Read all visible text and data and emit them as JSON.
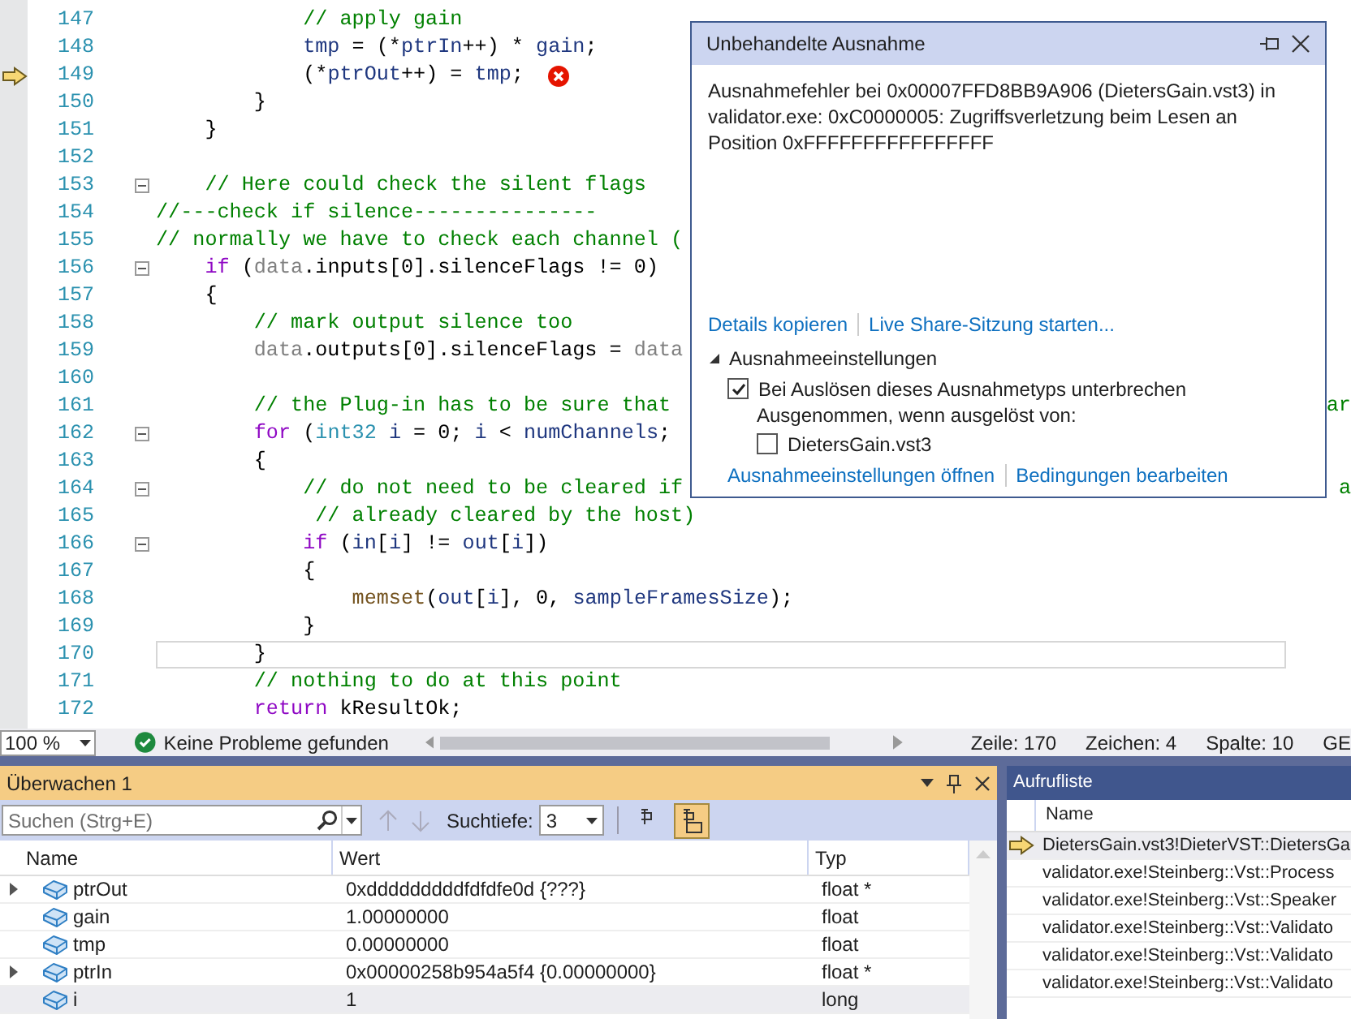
{
  "editor": {
    "lines": [
      {
        "number": "147",
        "execution_point": false,
        "caret_line": false,
        "has_error": false,
        "collapsible": false,
        "segments": [
          {
            "kind": "comment",
            "text": "            // apply gain"
          }
        ]
      },
      {
        "number": "148",
        "execution_point": false,
        "caret_line": false,
        "has_error": false,
        "collapsible": false,
        "segments": [
          {
            "kind": "var",
            "text": "            tmp"
          },
          {
            "kind": "plain",
            "text": " = (*"
          },
          {
            "kind": "var",
            "text": "ptrIn"
          },
          {
            "kind": "plain",
            "text": "++) * "
          },
          {
            "kind": "var",
            "text": "gain"
          },
          {
            "kind": "plain",
            "text": ";"
          }
        ]
      },
      {
        "number": "149",
        "execution_point": true,
        "caret_line": false,
        "has_error": true,
        "collapsible": false,
        "segments": [
          {
            "kind": "plain",
            "text": "            (*"
          },
          {
            "kind": "var",
            "text": "ptrOut"
          },
          {
            "kind": "plain",
            "text": "++) = "
          },
          {
            "kind": "var",
            "text": "tmp"
          },
          {
            "kind": "plain",
            "text": ";"
          }
        ]
      },
      {
        "number": "150",
        "execution_point": false,
        "caret_line": false,
        "has_error": false,
        "collapsible": false,
        "segments": [
          {
            "kind": "plain",
            "text": "        }"
          }
        ]
      },
      {
        "number": "151",
        "execution_point": false,
        "caret_line": false,
        "has_error": false,
        "collapsible": false,
        "segments": [
          {
            "kind": "plain",
            "text": "    }"
          }
        ]
      },
      {
        "number": "152",
        "execution_point": false,
        "caret_line": false,
        "has_error": false,
        "collapsible": false
      },
      {
        "number": "153",
        "execution_point": false,
        "caret_line": false,
        "has_error": false,
        "collapsible": true,
        "segments": [
          {
            "kind": "comment",
            "text": "    // Here could check the silent flags"
          }
        ]
      },
      {
        "number": "154",
        "execution_point": false,
        "caret_line": false,
        "has_error": false,
        "collapsible": false,
        "segments": [
          {
            "kind": "comment",
            "text": "//---check if silence---------------"
          }
        ]
      },
      {
        "number": "155",
        "execution_point": false,
        "caret_line": false,
        "has_error": false,
        "collapsible": false,
        "segments": [
          {
            "kind": "comment",
            "text": "// normally we have to check each channel ("
          }
        ]
      },
      {
        "number": "156",
        "execution_point": false,
        "caret_line": false,
        "has_error": false,
        "collapsible": true,
        "segments": [
          {
            "kind": "keyword",
            "text": "    if"
          },
          {
            "kind": "plain",
            "text": " ("
          },
          {
            "kind": "param",
            "text": "data"
          },
          {
            "kind": "plain",
            "text": ".inputs[0].silenceFlags != 0)"
          }
        ]
      },
      {
        "number": "157",
        "execution_point": false,
        "caret_line": false,
        "has_error": false,
        "collapsible": false,
        "segments": [
          {
            "kind": "plain",
            "text": "    {"
          }
        ]
      },
      {
        "number": "158",
        "execution_point": false,
        "caret_line": false,
        "has_error": false,
        "collapsible": false,
        "segments": [
          {
            "kind": "comment",
            "text": "        // mark output silence too"
          }
        ]
      },
      {
        "number": "159",
        "execution_point": false,
        "caret_line": false,
        "has_error": false,
        "collapsible": false,
        "segments": [
          {
            "kind": "param",
            "text": "        data"
          },
          {
            "kind": "plain",
            "text": ".outputs[0].silenceFlags = "
          },
          {
            "kind": "param",
            "text": "data"
          }
        ]
      },
      {
        "number": "160",
        "execution_point": false,
        "caret_line": false,
        "has_error": false,
        "collapsible": false
      },
      {
        "number": "161",
        "execution_point": false,
        "caret_line": false,
        "has_error": false,
        "collapsible": false,
        "segments": [
          {
            "kind": "comment",
            "text": "        // the Plug-in has to be sure that"
          }
        ],
        "tail": "ar"
      },
      {
        "number": "162",
        "execution_point": false,
        "caret_line": false,
        "has_error": false,
        "collapsible": true,
        "segments": [
          {
            "kind": "keyword",
            "text": "        for"
          },
          {
            "kind": "plain",
            "text": " ("
          },
          {
            "kind": "type",
            "text": "int32"
          },
          {
            "kind": "var",
            "text": " i"
          },
          {
            "kind": "plain",
            "text": " = 0; "
          },
          {
            "kind": "var",
            "text": "i"
          },
          {
            "kind": "plain",
            "text": " < "
          },
          {
            "kind": "var",
            "text": "numChannels"
          },
          {
            "kind": "plain",
            "text": ";"
          }
        ]
      },
      {
        "number": "163",
        "execution_point": false,
        "caret_line": false,
        "has_error": false,
        "collapsible": false,
        "segments": [
          {
            "kind": "plain",
            "text": "        {"
          }
        ]
      },
      {
        "number": "164",
        "execution_point": false,
        "caret_line": false,
        "has_error": false,
        "collapsible": true,
        "segments": [
          {
            "kind": "comment",
            "text": "            // do not need to be cleared if"
          }
        ],
        "tail": "a"
      },
      {
        "number": "165",
        "execution_point": false,
        "caret_line": false,
        "has_error": false,
        "collapsible": false,
        "segments": [
          {
            "kind": "comment",
            "text": "             // already cleared by the host)"
          }
        ]
      },
      {
        "number": "166",
        "execution_point": false,
        "caret_line": false,
        "has_error": false,
        "collapsible": true,
        "segments": [
          {
            "kind": "keyword",
            "text": "            if"
          },
          {
            "kind": "plain",
            "text": " ("
          },
          {
            "kind": "var",
            "text": "in"
          },
          {
            "kind": "plain",
            "text": "["
          },
          {
            "kind": "var",
            "text": "i"
          },
          {
            "kind": "plain",
            "text": "] != "
          },
          {
            "kind": "var",
            "text": "out"
          },
          {
            "kind": "plain",
            "text": "["
          },
          {
            "kind": "var",
            "text": "i"
          },
          {
            "kind": "plain",
            "text": "])"
          }
        ]
      },
      {
        "number": "167",
        "execution_point": false,
        "caret_line": false,
        "has_error": false,
        "collapsible": false,
        "segments": [
          {
            "kind": "plain",
            "text": "            {"
          }
        ]
      },
      {
        "number": "168",
        "execution_point": false,
        "caret_line": false,
        "has_error": false,
        "collapsible": false,
        "segments": [
          {
            "kind": "func",
            "text": "                memset"
          },
          {
            "kind": "plain",
            "text": "("
          },
          {
            "kind": "var",
            "text": "out"
          },
          {
            "kind": "plain",
            "text": "["
          },
          {
            "kind": "var",
            "text": "i"
          },
          {
            "kind": "plain",
            "text": "], 0, "
          },
          {
            "kind": "var",
            "text": "sampleFramesSize"
          },
          {
            "kind": "plain",
            "text": ");"
          }
        ]
      },
      {
        "number": "169",
        "execution_point": false,
        "caret_line": false,
        "has_error": false,
        "collapsible": false,
        "segments": [
          {
            "kind": "plain",
            "text": "            }"
          }
        ]
      },
      {
        "number": "170",
        "execution_point": false,
        "caret_line": true,
        "has_error": false,
        "collapsible": false,
        "segments": [
          {
            "kind": "plain",
            "text": "        }"
          }
        ]
      },
      {
        "number": "171",
        "execution_point": false,
        "caret_line": false,
        "has_error": false,
        "collapsible": false,
        "segments": [
          {
            "kind": "comment",
            "text": "        // nothing to do at this point"
          }
        ]
      },
      {
        "number": "172",
        "execution_point": false,
        "caret_line": false,
        "has_error": false,
        "collapsible": false,
        "segments": [
          {
            "kind": "keyword",
            "text": "        return"
          },
          {
            "kind": "plain",
            "text": " kResultOk;"
          }
        ]
      }
    ]
  },
  "exception_popup": {
    "title": "Unbehandelte Ausnahme",
    "message": "Ausnahmefehler bei 0x00007FFD8BB9A906 (DietersGain.vst3) in validator.exe: 0xC0000005: Zugriffsverletzung beim Lesen an Position 0xFFFFFFFFFFFFFFFF",
    "links": [
      "Details kopieren",
      "Live Share-Sitzung starten..."
    ],
    "settings": {
      "label": "Ausnahmeeinstellungen",
      "expanded": true,
      "break_option": {
        "label": "Bei Auslösen dieses Ausnahmetyps unterbrechen",
        "checked": true
      },
      "except_label": "Ausgenommen, wenn ausgelöst von:",
      "except_modules": [
        {
          "label": "DietersGain.vst3",
          "checked": false
        }
      ]
    },
    "footer_links": [
      "Ausnahmeeinstellungen öffnen",
      "Bedingungen bearbeiten"
    ]
  },
  "status_bar": {
    "zoom": "100 %",
    "problems": "Keine Probleme gefunden",
    "position": [
      "Zeile: 170",
      "Zeichen: 4",
      "Spalte: 10",
      "GE"
    ]
  },
  "watch": {
    "title": "Überwachen 1",
    "search_placeholder": "Suchen (Strg+E)",
    "depth_label": "Suchtiefe:",
    "depth": "3",
    "toggles": [
      {
        "selected": false
      },
      {
        "selected": true
      }
    ],
    "columns": [
      "Name",
      "Wert",
      "Typ"
    ],
    "rows": [
      {
        "name": "ptrOut",
        "value": "0xdddddddddfdfdfe0d {???}",
        "type": "float *",
        "expandable": true,
        "selected": false
      },
      {
        "name": "gain",
        "value": "1.00000000",
        "type": "float",
        "expandable": false,
        "selected": false
      },
      {
        "name": "tmp",
        "value": "0.00000000",
        "type": "float",
        "expandable": false,
        "selected": false
      },
      {
        "name": "ptrIn",
        "value": "0x00000258b954a5f4 {0.00000000}",
        "type": "float *",
        "expandable": true,
        "selected": false
      },
      {
        "name": "i",
        "value": "1",
        "type": "long",
        "expandable": false,
        "selected": true
      }
    ]
  },
  "call_stack": {
    "title": "Aufrufliste",
    "column": "Name",
    "frames": [
      {
        "text": "DietersGain.vst3!DieterVST::DietersGa",
        "current": true
      },
      {
        "text": "validator.exe!Steinberg::Vst::Process",
        "current": false
      },
      {
        "text": "validator.exe!Steinberg::Vst::Speaker",
        "current": false
      },
      {
        "text": "validator.exe!Steinberg::Vst::Validato",
        "current": false
      },
      {
        "text": "validator.exe!Steinberg::Vst::Validato",
        "current": false
      },
      {
        "text": "validator.exe!Steinberg::Vst::Validato",
        "current": false
      }
    ]
  }
}
